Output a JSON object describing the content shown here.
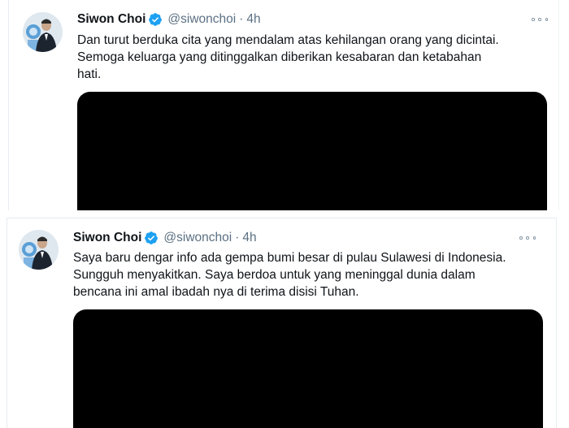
{
  "tweets": [
    {
      "author_name": "Siwon Choi",
      "handle": "@siwonchoi",
      "separator": "·",
      "time": "4h",
      "text": "Dan turut berduka cita yang mendalam atas kehilangan orang yang dicintai.\nSemoga keluarga yang ditinggalkan diberikan kesabaran dan ketabahan\nhati.",
      "verified_icon": "verified-badge-icon",
      "more_icon": "more-options-icon",
      "media_color": "#000000"
    },
    {
      "author_name": "Siwon Choi",
      "handle": "@siwonchoi",
      "separator": "·",
      "time": "4h",
      "text": "Saya baru dengar info ada gempa bumi besar di pulau Sulawesi di Indonesia.\nSungguh menyakitkan. Saya berdoa untuk yang meninggal dunia dalam\nbencana ini amal ibadah nya di terima disisi Tuhan.",
      "verified_icon": "verified-badge-icon",
      "more_icon": "more-options-icon",
      "media_color": "#000000"
    }
  ],
  "colors": {
    "verified_blue": "#1da1f2",
    "secondary_text": "#5b7083",
    "primary_text": "#0f1419",
    "border": "#e6ecf0"
  }
}
